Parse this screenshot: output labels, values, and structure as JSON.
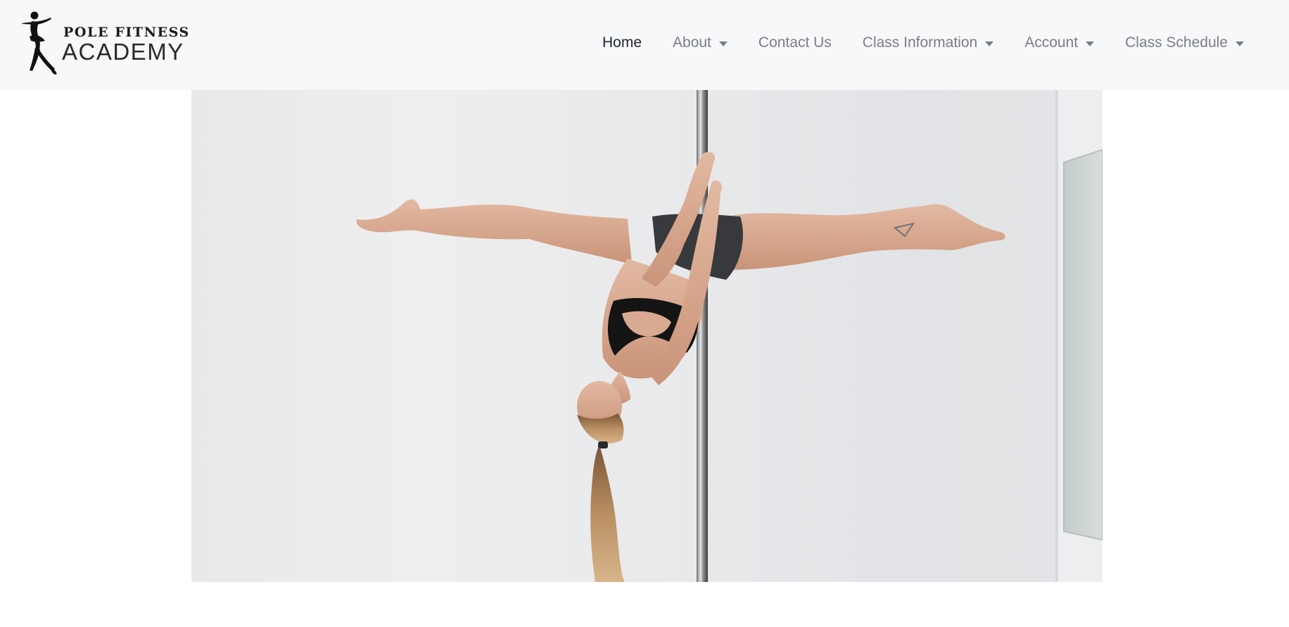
{
  "brand": {
    "name_top": "POLE FITNESS",
    "name_bottom": "ACADEMY",
    "logo_icon": "dancer-silhouette-icon"
  },
  "nav": {
    "items": [
      {
        "label": "Home",
        "active": true,
        "dropdown": false
      },
      {
        "label": "About",
        "active": false,
        "dropdown": true
      },
      {
        "label": "Contact Us",
        "active": false,
        "dropdown": false
      },
      {
        "label": "Class Information",
        "active": false,
        "dropdown": true
      },
      {
        "label": "Account",
        "active": false,
        "dropdown": true
      },
      {
        "label": "Class Schedule",
        "active": false,
        "dropdown": true
      }
    ]
  },
  "hero": {
    "image": "pole-dancer-inverted-split-photo"
  },
  "colors": {
    "navbar_bg": "#f7f8fa",
    "nav_text": "#7b7e82",
    "nav_active": "#212529",
    "page_bg": "#ffffff"
  }
}
